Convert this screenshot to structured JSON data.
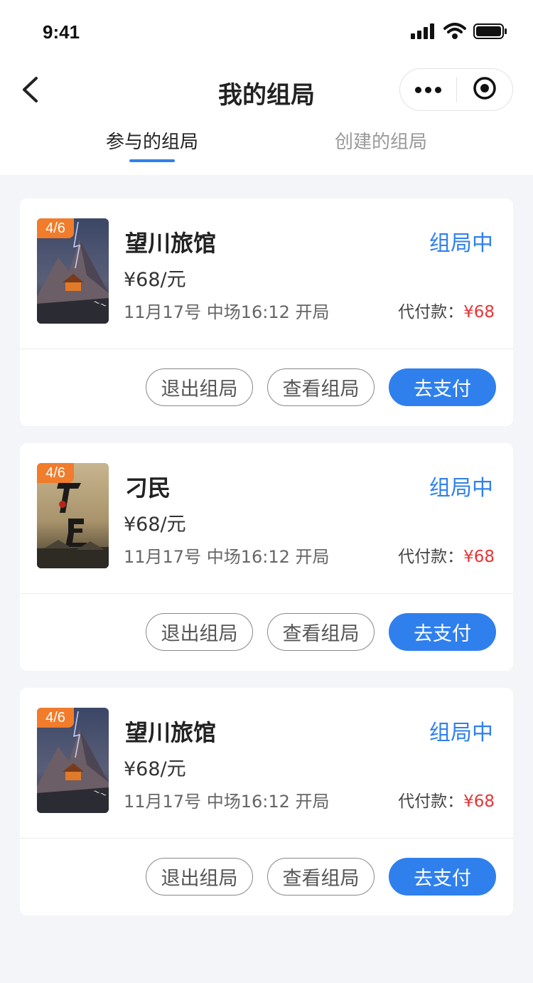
{
  "status_bar": {
    "time": "9:41"
  },
  "nav": {
    "title": "我的组局"
  },
  "tabs": [
    {
      "label": "参与的组局",
      "active": true
    },
    {
      "label": "创建的组局",
      "active": false
    }
  ],
  "colors": {
    "accent": "#2f80ed",
    "price_red": "#e83434",
    "badge_orange": "#f07c2c"
  },
  "cards": [
    {
      "badge": "4/6",
      "title": "望川旅馆",
      "status": "组局中",
      "price": "¥68/元",
      "schedule": "11月17号 中场16:12 开局",
      "pay_label": "代付款：",
      "pay_amount": "¥68",
      "btn_quit": "退出组局",
      "btn_view": "查看组局",
      "btn_pay": "去支付"
    },
    {
      "badge": "4/6",
      "title": "刁民",
      "status": "组局中",
      "price": "¥68/元",
      "schedule": "11月17号 中场16:12 开局",
      "pay_label": "代付款：",
      "pay_amount": "¥68",
      "btn_quit": "退出组局",
      "btn_view": "查看组局",
      "btn_pay": "去支付"
    },
    {
      "badge": "4/6",
      "title": "望川旅馆",
      "status": "组局中",
      "price": "¥68/元",
      "schedule": "11月17号 中场16:12 开局",
      "pay_label": "代付款：",
      "pay_amount": "¥68",
      "btn_quit": "退出组局",
      "btn_view": "查看组局",
      "btn_pay": "去支付"
    }
  ]
}
